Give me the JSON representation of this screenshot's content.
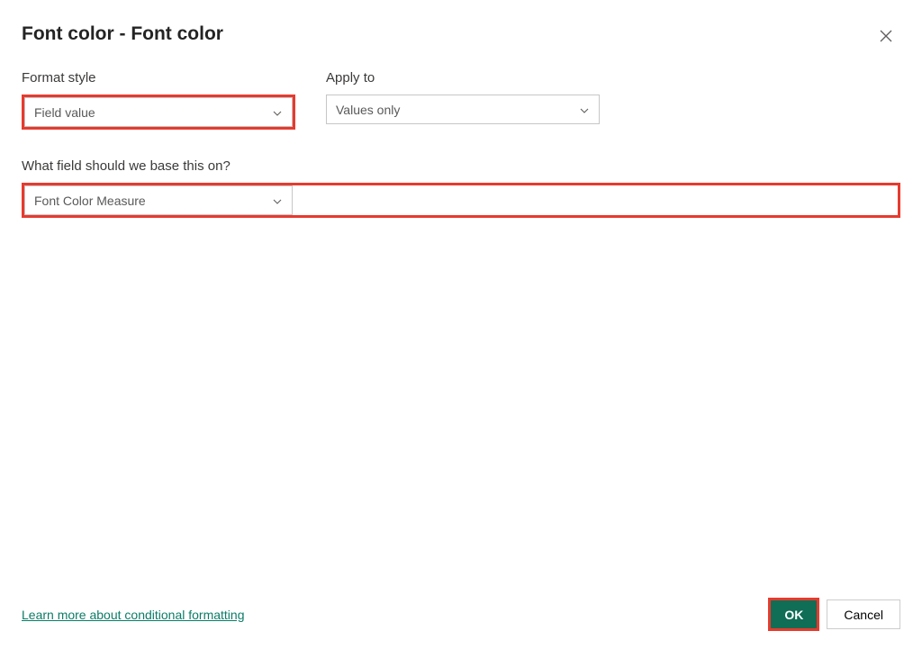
{
  "dialog": {
    "title": "Font color - Font color"
  },
  "formatStyle": {
    "label": "Format style",
    "value": "Field value"
  },
  "applyTo": {
    "label": "Apply to",
    "value": "Values only"
  },
  "baseField": {
    "label": "What field should we base this on?",
    "value": "Font Color Measure"
  },
  "footer": {
    "link": "Learn more about conditional formatting",
    "ok": "OK",
    "cancel": "Cancel"
  }
}
